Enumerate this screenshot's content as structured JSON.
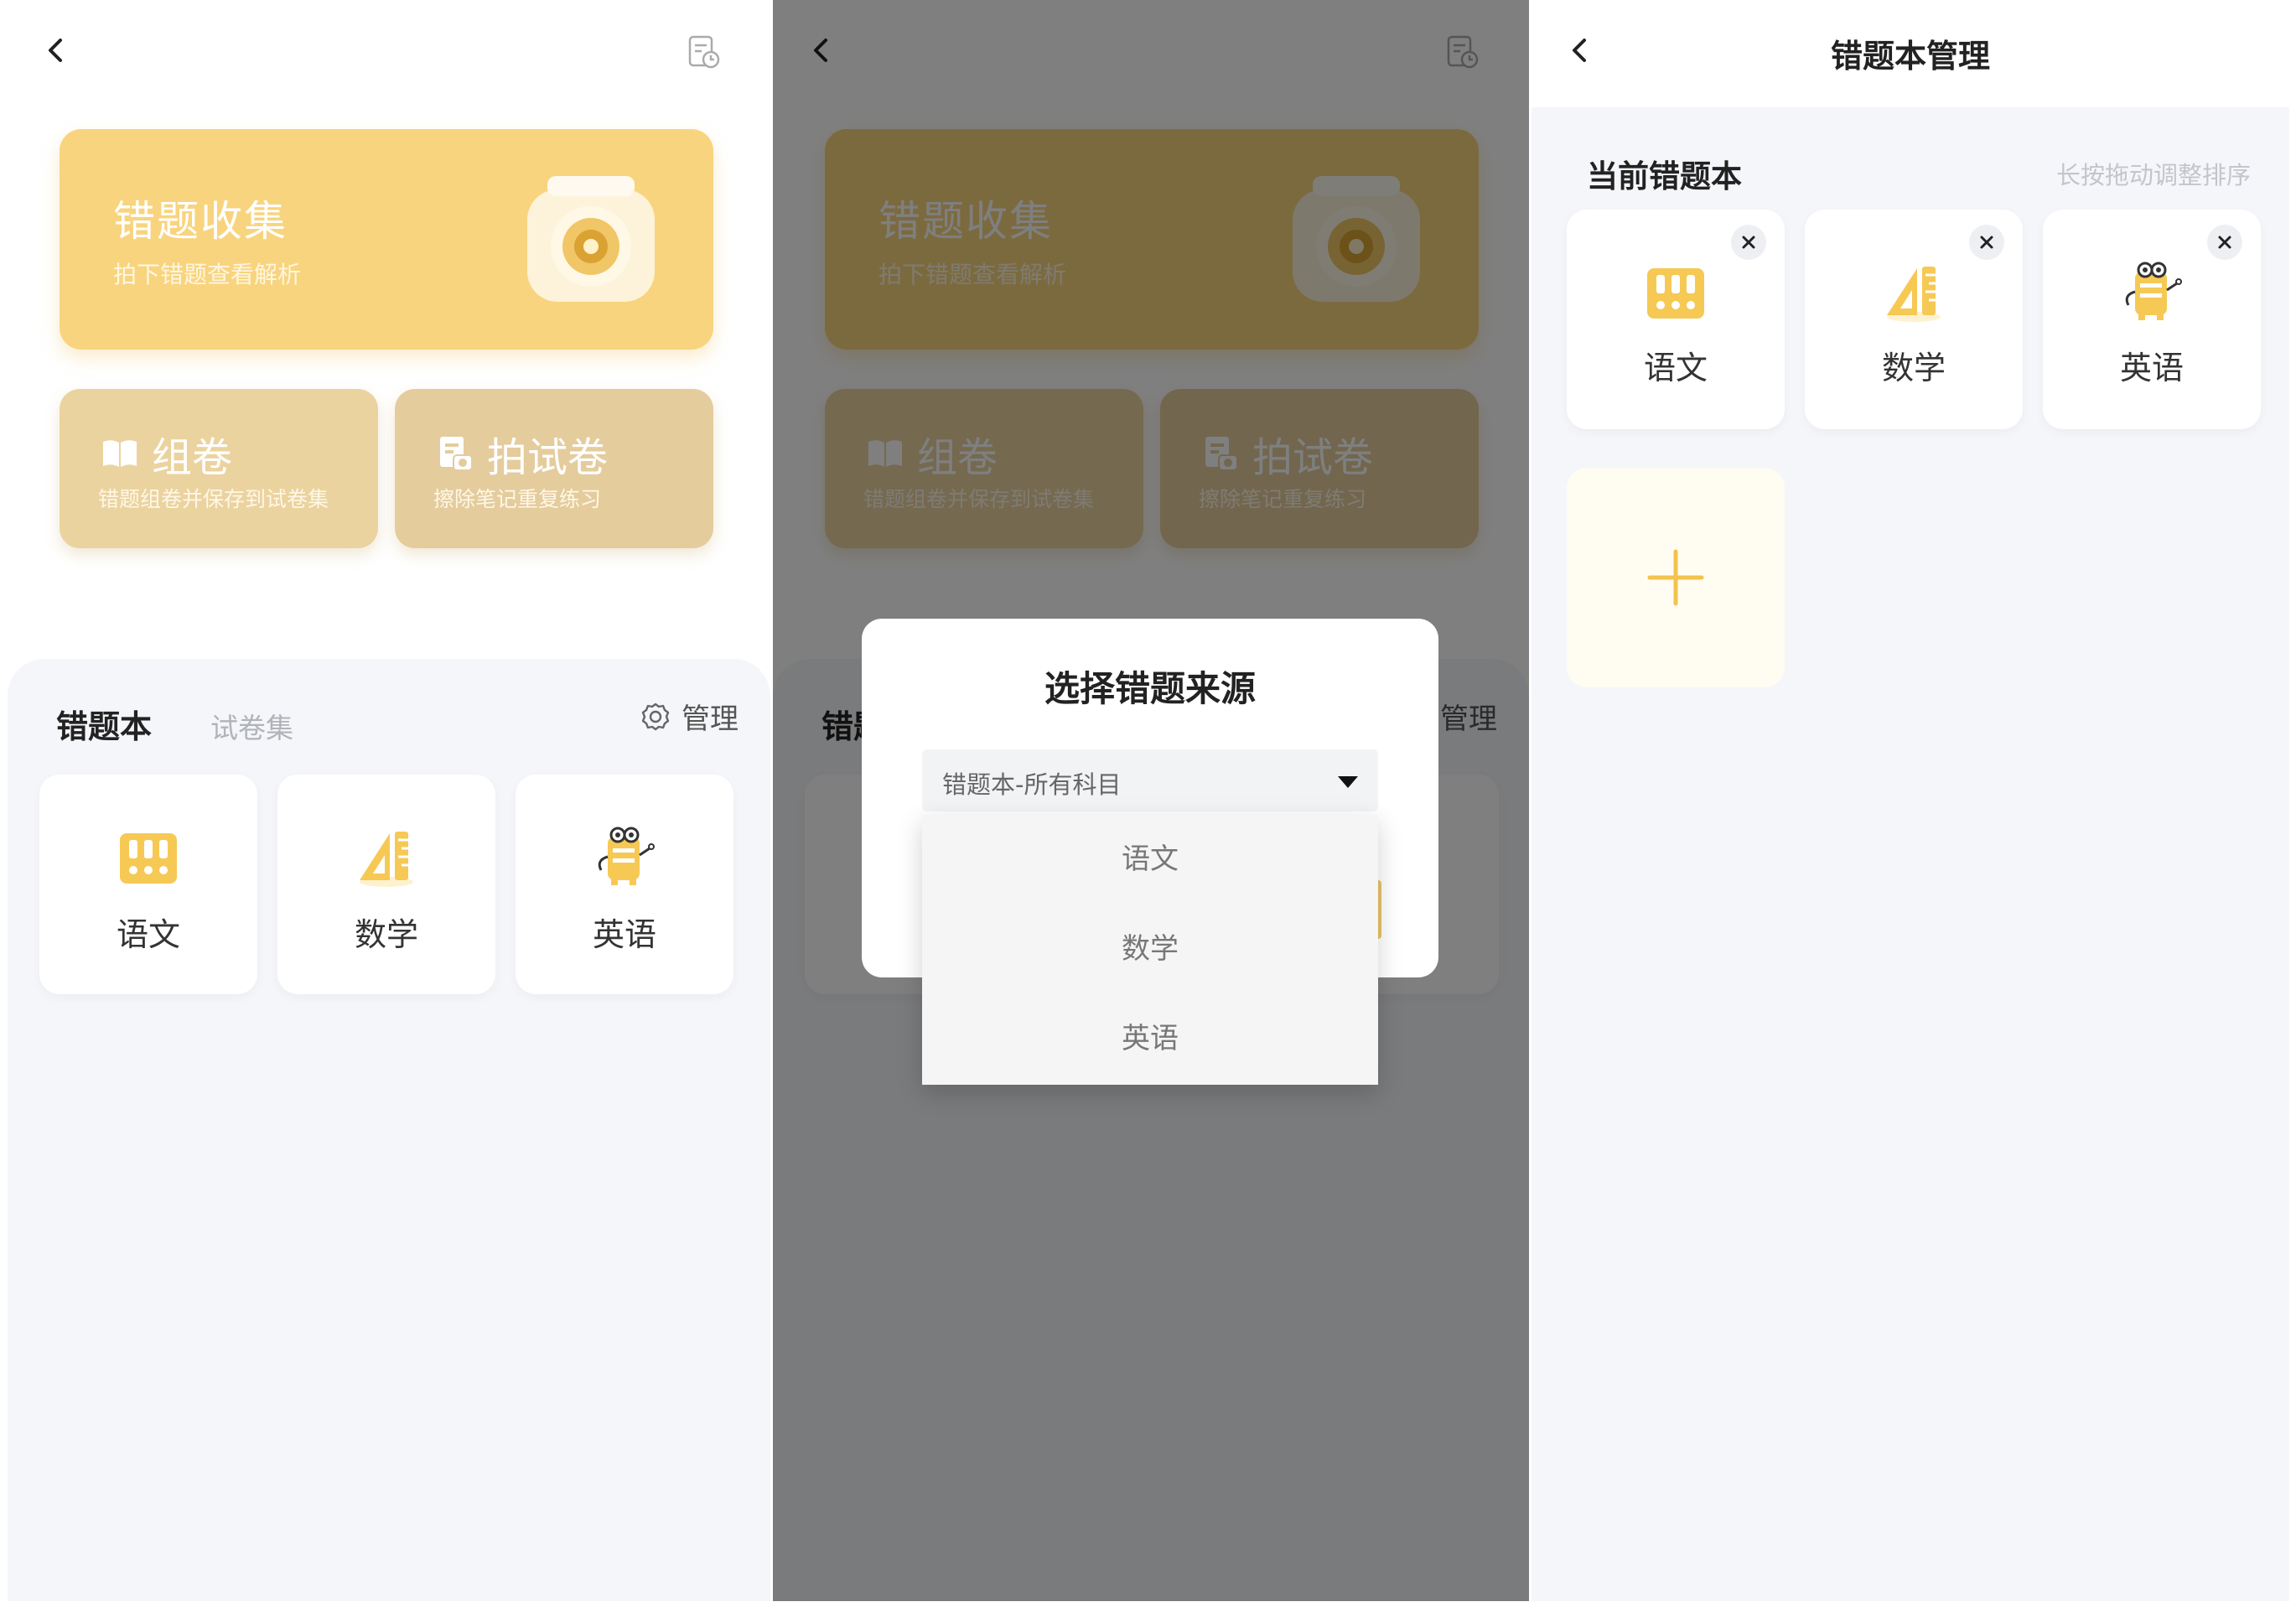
{
  "screen1": {
    "collect": {
      "title": "错题收集",
      "subtitle": "拍下错题查看解析"
    },
    "compose": {
      "title": "组卷",
      "subtitle": "错题组卷并保存到试卷集"
    },
    "photo": {
      "title": "拍试卷",
      "subtitle": "擦除笔记重复练习"
    },
    "tabs": {
      "active": "错题本",
      "inactive": "试卷集"
    },
    "manage_label": "管理",
    "subjects": [
      "语文",
      "数学",
      "英语"
    ]
  },
  "screen2": {
    "dialog_title": "选择错题来源",
    "select_value": "错题本-所有科目",
    "options": [
      "语文",
      "数学",
      "英语"
    ]
  },
  "screen3": {
    "title": "错题本管理",
    "section_label": "当前错题本",
    "hint": "长按拖动调整排序",
    "subjects": [
      "语文",
      "数学",
      "英语"
    ]
  },
  "colors": {
    "collect_card": "#f8d47e",
    "sub_card": "#ebd3a0",
    "sheet_bg": "#f5f6fa",
    "accent": "#f3c34f"
  },
  "icons": [
    "back-icon",
    "history-icon",
    "camera-icon",
    "book-icon",
    "scan-icon",
    "gear-icon",
    "books-icon",
    "ruler-icon",
    "mascot-icon",
    "close-icon",
    "plus-icon"
  ]
}
